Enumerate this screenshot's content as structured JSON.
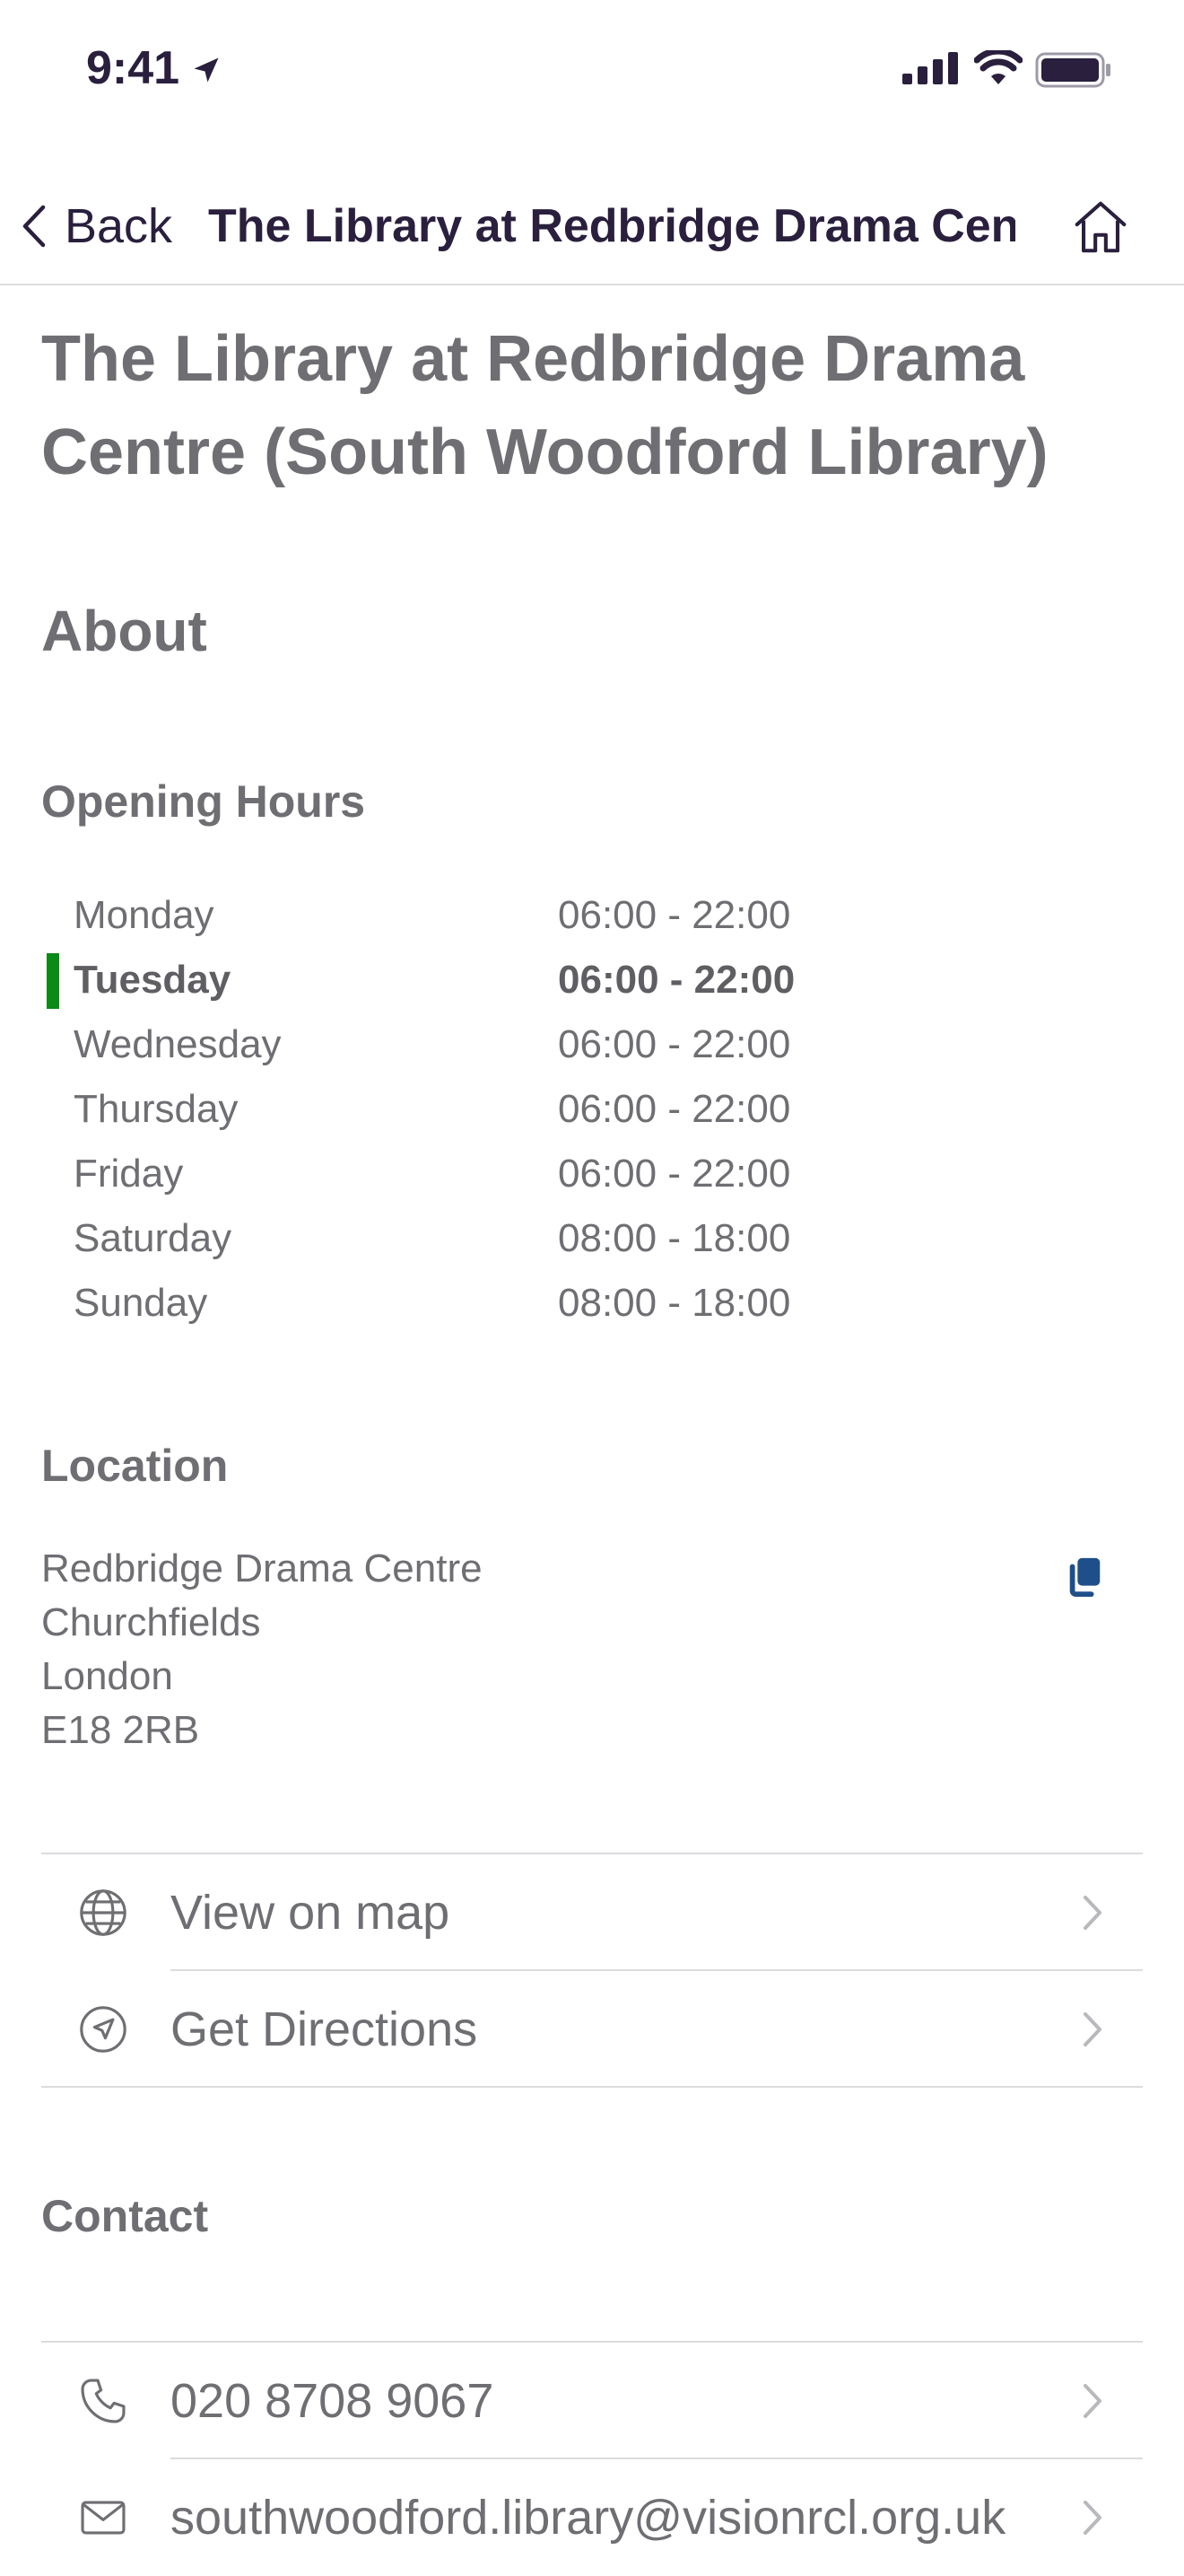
{
  "status_bar": {
    "time": "9:41"
  },
  "nav": {
    "back_label": "Back",
    "title": "The Library at Redbridge Drama Centre (South Woodford Library)"
  },
  "page": {
    "title": "The Library at Redbridge Drama Centre (South Woodford Library)",
    "about_heading": "About"
  },
  "opening_hours": {
    "heading": "Opening Hours",
    "today_color": "#0a8a16",
    "rows": [
      {
        "day": "Monday",
        "hours": "06:00 - 22:00"
      },
      {
        "day": "Tuesday",
        "hours": "06:00 - 22:00",
        "today": true
      },
      {
        "day": "Wednesday",
        "hours": "06:00 - 22:00"
      },
      {
        "day": "Thursday",
        "hours": "06:00 - 22:00"
      },
      {
        "day": "Friday",
        "hours": "06:00 - 22:00"
      },
      {
        "day": "Saturday",
        "hours": "08:00 - 18:00"
      },
      {
        "day": "Sunday",
        "hours": "08:00 - 18:00"
      }
    ]
  },
  "location": {
    "heading": "Location",
    "address_lines": [
      "Redbridge Drama Centre",
      "Churchfields",
      "London",
      "E18 2RB"
    ],
    "copy_icon": "copy-icon",
    "actions": [
      {
        "label": "View on map",
        "icon": "globe-icon"
      },
      {
        "label": "Get Directions",
        "icon": "directions-icon"
      }
    ]
  },
  "contact": {
    "heading": "Contact",
    "items": [
      {
        "label": "020 8708 9067",
        "icon": "phone-icon"
      },
      {
        "label": "southwoodford.library@visionrcl.org.uk",
        "icon": "mail-icon"
      }
    ]
  },
  "colors": {
    "accent": "#2a1f3d",
    "copy": "#1f4f8a"
  }
}
